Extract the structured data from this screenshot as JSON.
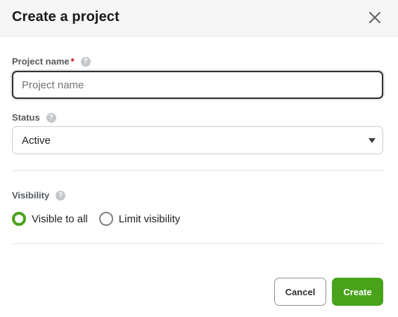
{
  "dialog": {
    "title": "Create a project",
    "close_icon": "close-icon"
  },
  "form": {
    "project_name": {
      "label": "Project name",
      "required_mark": "*",
      "help_icon": "question-icon",
      "placeholder": "Project name",
      "value": ""
    },
    "status": {
      "label": "Status",
      "help_icon": "question-icon",
      "selected": "Active",
      "icon": "caret-down-icon"
    },
    "visibility": {
      "label": "Visibility",
      "help_icon": "question-icon",
      "options": [
        {
          "label": "Visible to all",
          "checked": true
        },
        {
          "label": "Limit visibility",
          "checked": false
        }
      ]
    }
  },
  "footer": {
    "cancel_label": "Cancel",
    "create_label": "Create"
  },
  "colors": {
    "accent": "#4aa21b",
    "required": "#d0021b",
    "header_bg": "#f6f6f6"
  }
}
